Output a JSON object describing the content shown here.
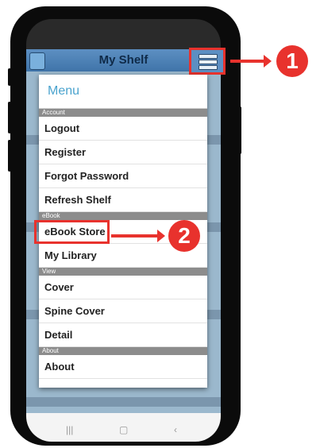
{
  "app": {
    "title": "My Shelf"
  },
  "menu": {
    "heading": "Menu",
    "sections": [
      {
        "label": "Account",
        "items": [
          "Logout",
          "Register",
          "Forgot Password",
          "Refresh Shelf"
        ]
      },
      {
        "label": "eBook",
        "items": [
          "eBook Store",
          "My Library"
        ]
      },
      {
        "label": "View",
        "items": [
          "Cover",
          "Spine Cover",
          "Detail"
        ]
      },
      {
        "label": "About",
        "items": [
          "About"
        ]
      }
    ]
  },
  "callouts": {
    "step1": "1",
    "step2": "2"
  },
  "colors": {
    "accent": "#e8322d",
    "menu_heading": "#4aa3ce",
    "section_bar": "#8c8c8c",
    "header": "#4f82b6"
  },
  "icons": {
    "menu_button": "hamburger-list-icon",
    "app_logo": "shelf-logo-icon"
  }
}
